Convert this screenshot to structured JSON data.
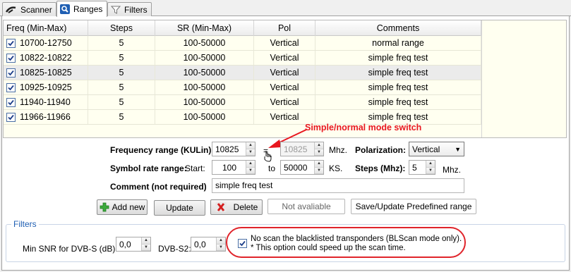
{
  "tabs": [
    {
      "label": "Scanner",
      "icon": "satellite-dish-icon"
    },
    {
      "label": "Ranges",
      "icon": "magnifier-icon"
    },
    {
      "label": "Filters",
      "icon": "funnel-icon"
    }
  ],
  "grid": {
    "columns": [
      "Freq (Min-Max)",
      "Steps",
      "SR (Min-Max)",
      "Pol",
      "Comments"
    ],
    "rows": [
      {
        "checked": true,
        "freq": "10700-12750",
        "steps": "5",
        "sr": "100-50000",
        "pol": "Vertical",
        "comment": "normal range"
      },
      {
        "checked": true,
        "freq": "10822-10822",
        "steps": "5",
        "sr": "100-50000",
        "pol": "Vertical",
        "comment": "simple freq test"
      },
      {
        "checked": true,
        "freq": "10825-10825",
        "steps": "5",
        "sr": "100-50000",
        "pol": "Vertical",
        "comment": "simple freq test",
        "selected": true
      },
      {
        "checked": true,
        "freq": "10925-10925",
        "steps": "5",
        "sr": "100-50000",
        "pol": "Vertical",
        "comment": "simple freq test"
      },
      {
        "checked": true,
        "freq": "11940-11940",
        "steps": "5",
        "sr": "100-50000",
        "pol": "Vertical",
        "comment": "simple freq test"
      },
      {
        "checked": true,
        "freq": "11966-11966",
        "steps": "5",
        "sr": "100-50000",
        "pol": "Vertical",
        "comment": "simple freq test"
      }
    ]
  },
  "annotation": {
    "text": "Simple/normal mode switch",
    "color": "#e8171f"
  },
  "form": {
    "freq_label": "Frequency range (KULin):",
    "freq_min": "10825",
    "equals": "=",
    "freq_max": "10825",
    "mhz": "Mhz.",
    "pol_label": "Polarization:",
    "pol_value": "Vertical",
    "sr_label": "Symbol rate range:",
    "start_label": "Start:",
    "sr_start": "100",
    "to_label": "to",
    "sr_end": "50000",
    "ks": "KS.",
    "steps_label": "Steps (Mhz):",
    "steps_value": "5",
    "steps_unit": "Mhz.",
    "comment_label": "Comment (not required)",
    "comment_value": "simple freq test"
  },
  "buttons": {
    "add": "Add new",
    "update": "Update",
    "delete": "Delete",
    "not_available": "Not avaliable",
    "save_predefined": "Save/Update Predefined range"
  },
  "filters": {
    "title": "Filters",
    "snr_s_label": "Min SNR for DVB-S (dB):",
    "snr_s_value": "0,0",
    "s2_label": "DVB-S2:",
    "s2_value": "0,0",
    "blacklist_checked": true,
    "blacklist_line1": "No scan the blacklisted transponders (BLScan mode only).",
    "blacklist_line2": "* This option could speed up the scan time."
  },
  "colors": {
    "accent_red": "#e0242b",
    "grid_bg": "#fffff0",
    "group_title": "#1f5fb3"
  }
}
